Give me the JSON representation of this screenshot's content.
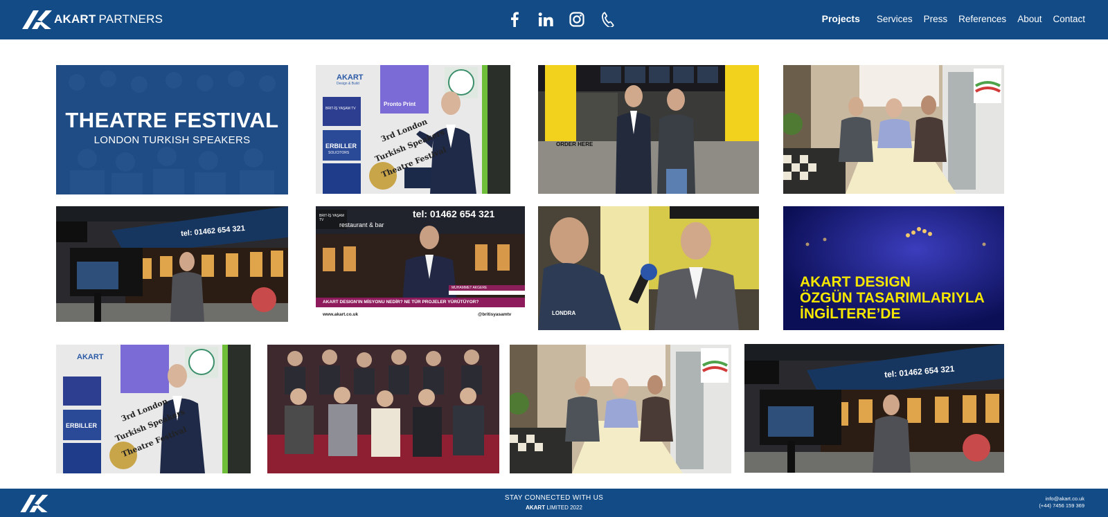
{
  "brand": {
    "name_bold": "AKART",
    "name_light": "PARTNERS"
  },
  "colors": {
    "primary": "#124b86",
    "accent_yellow": "#f5e600",
    "festival_overlay": "#1d4f8c",
    "design_bg": "#141a7a"
  },
  "header": {
    "social": [
      {
        "name": "facebook-icon"
      },
      {
        "name": "linkedin-icon"
      },
      {
        "name": "instagram-icon"
      },
      {
        "name": "phone-icon"
      }
    ],
    "nav": [
      {
        "label": "Projects",
        "active": true
      },
      {
        "label": "Services"
      },
      {
        "label": "Press"
      },
      {
        "label": "References"
      },
      {
        "label": "About"
      },
      {
        "label": "Contact"
      }
    ]
  },
  "gallery": {
    "festival": {
      "title": "THEATRE FESTIVAL",
      "subtitle": "LONDON TURKISH SPEAKERS"
    },
    "design": {
      "lines": [
        "AKART DESIGN",
        "ÖZGÜN TASARIMLARIYLA",
        "İNGİLTERE’DE"
      ]
    },
    "festival_board": {
      "sponsors": [
        "AKART",
        "Design & Build",
        "BRIT-İŞ YAŞAM TV",
        "ERBILLER",
        "SOLICITORS",
        "Pronto Print"
      ],
      "sign": [
        "3rd London",
        "Turkish Speakers",
        "Theatre Festival"
      ]
    },
    "restaurant": {
      "phone_sign": "tel: 01462 654 321",
      "bar_sign": "restaurant & bar"
    },
    "broadcast": {
      "phone": "tel: 01462 654 321",
      "name_bar": "MUHAMMET AKGERE",
      "caption": "AKART DESIGN'IN MİSYONU NEDİR? NE TÜR PROJELER YÜRÜTÜYOR?",
      "website": "www.akart.co.uk",
      "handle": "@britisyasamtv",
      "channel": "BRIT-İŞ YAŞAM TV"
    },
    "counter_sign": "ORDER HERE",
    "mic_label": "LONDRA"
  },
  "footer": {
    "stay": "STAY CONNECTED WITH US",
    "copyright_bold": "AKART",
    "copyright_rest": "LIMITED 2022",
    "email": "info@akart.co.uk",
    "phone": "(+44) 7456 159 369"
  }
}
